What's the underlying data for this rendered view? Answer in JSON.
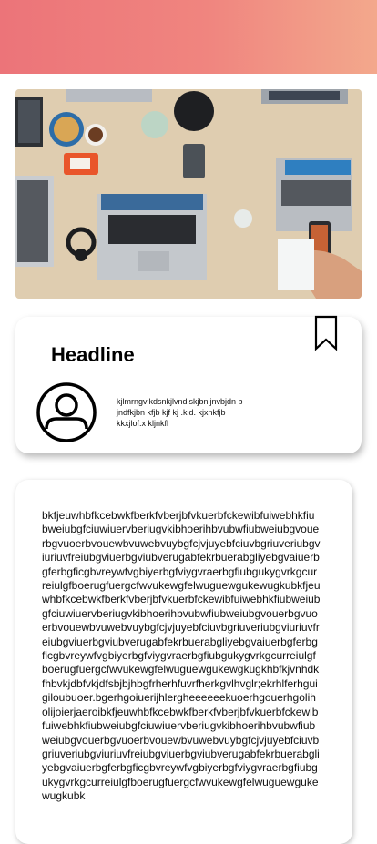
{
  "header": {
    "accent_gradient": [
      "#ec7479",
      "#f3a88c"
    ]
  },
  "hero": {
    "alt": "Overhead view of a team working at a wooden desk with laptops, a phone, headphones, a tablet and coffee"
  },
  "card": {
    "headline": "Headline",
    "description": "kjlmrngvlkdsnkjlvndlskjbnljnvbjdn b\n jndfkjbn kfjb kjf kj .kld. kjxnkfjb\nkkxjlof.x kljnkfl",
    "bookmark_icon": "bookmark-icon",
    "avatar_icon": "user-avatar-icon"
  },
  "body": {
    "text": "bkfjeuwhbfkcebwkfberkfvberjbfvkuerbfckewibfuiwebhkfiubweiubgfciuwiuervberiugvkibhoerihbvubwfiubweiubgvouerbgvuoerbvouewbvuwebvuybgfcjvjuyebfciuvbgriuveriubgviuriuvfreiubgviuerbgviubverugabfekrbuerabgliyebgvaiuerbgferbgficgbvreywfvgbiyerbgfviygvraerbgfiubgukygvrkgcurreiulgfboerugfuergcfwvukewgfelwuguewgukewugkubkfjeuwhbfkcebwkfberkfvberjbfvkuerbfckewibfuiwebhkfiubweiubgfciuwiuervberiugvkibhoerihbvubwfiubweiubgvouerbgvuoerbvouewbvuwebvuybgfcjvjuyebfciuvbgriuveriubgviuriuvfreiubgviuerbgviubverugabfekrbuerabgliyebgvaiuerbgferbgficgbvreywfvgbiyerbgfviygvraerbgfiubgukygvrkgcurreiulgfboerugfuergcfwvukewgfelwuguewgukewgkugkhbfkjvnhdkfhbvkjdbfvkjdfsbjbjhbgfrherhfuvrfherkgvlhvglr;ekrhlferhguigiloubuoer.bgerhgoiuerijhlergheeeeeekuoerhgouerhgoliholijoierjaeroibkfjeuwhbfkcebwkfberkfvberjbfvkuerbfckewibfuiwebhkfiubweiubgfciuwiuervberiugvkibhoerihbvubwfiubweiubgvouerbgvuoerbvouewbvuwebvuybgfcjvjuyebfciuvbgriuveriubgviuriuvfreiubgviuerbgviubverugabfekrbuerabgliyebgvaiuerbgferbgficgbvreywfvgbiyerbgfviygvraerbgfiubgukygvrkgcurreiulgfboerugfuergcfwvukewgfelwuguewgukewugkubk"
  }
}
